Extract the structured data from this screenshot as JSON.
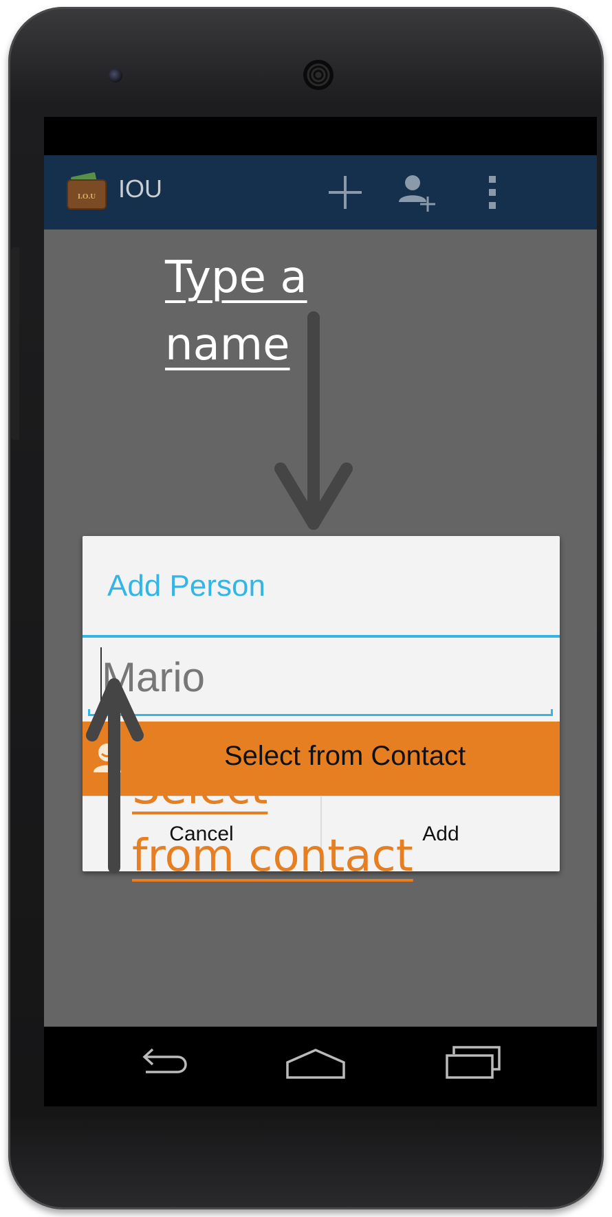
{
  "app": {
    "title": "IOU",
    "logo_text": "I.O.U",
    "actions": [
      {
        "name": "add",
        "icon": "plus-icon"
      },
      {
        "name": "add-person",
        "icon": "add-person-icon"
      },
      {
        "name": "overflow",
        "icon": "overflow-menu-icon"
      }
    ]
  },
  "dialog": {
    "title": "Add Person",
    "input_value": "Mario",
    "select_contact_label": "Select from Contact",
    "cancel_label": "Cancel",
    "add_label": "Add"
  },
  "annotations": {
    "type_name": [
      "Type a",
      "name"
    ],
    "select_contact": [
      "Select",
      "from contact"
    ]
  },
  "navigation": [
    "back-icon",
    "home-icon",
    "recent-apps-icon"
  ],
  "colors": {
    "action_bar": "#15304c",
    "accent_blue": "#33b5e5",
    "accent_orange": "#e67e22",
    "screen_bg": "#656565"
  }
}
